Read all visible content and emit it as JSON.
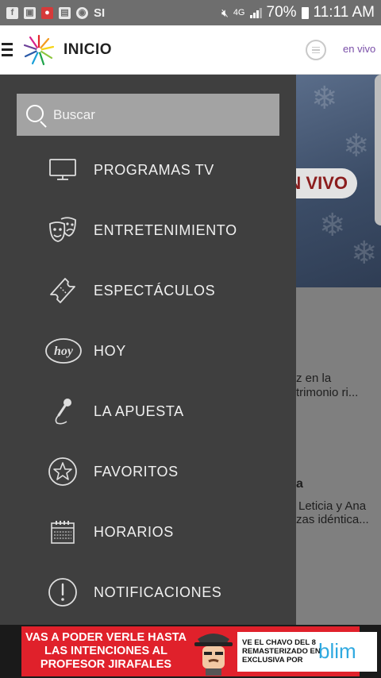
{
  "status_bar": {
    "left_icons": [
      "facebook-icon",
      "image-icon",
      "app-icon",
      "clipboard-icon",
      "cbs-icon",
      "si-icon"
    ],
    "si_text": "SI",
    "network": "4G",
    "battery_percent": "70%",
    "time": "11:11 AM"
  },
  "header": {
    "title": "INICIO",
    "live_link": "en vivo"
  },
  "search": {
    "placeholder": "Buscar"
  },
  "menu": {
    "items": [
      {
        "label": "PROGRAMAS TV",
        "icon": "tv-icon"
      },
      {
        "label": "ENTRETENIMIENTO",
        "icon": "theater-masks-icon"
      },
      {
        "label": "ESPECTÁCULOS",
        "icon": "ticket-icon"
      },
      {
        "label": "HOY",
        "icon": "hoy-logo-icon"
      },
      {
        "label": "LA APUESTA",
        "icon": "microphone-icon"
      },
      {
        "label": "FAVORITOS",
        "icon": "star-icon"
      },
      {
        "label": "HORARIOS",
        "icon": "calendar-icon"
      },
      {
        "label": "NOTIFICACIONES",
        "icon": "alert-icon"
      }
    ]
  },
  "background": {
    "live_badge": "N VIVO",
    "snippet1_line1": "z en la",
    "snippet1_line2": "trimonio ri...",
    "snippet2_title": "a",
    "snippet2_line1": "Leticia y Ana",
    "snippet2_line2": "zas idéntica..."
  },
  "ad": {
    "headline_line1": "VAS A PODER VERLE HASTA",
    "headline_line2": "LAS INTENCIONES AL",
    "headline_line3": "PROFESOR JIRAFALES",
    "small_line1": "VE EL CHAVO DEL 8",
    "small_line2": "REMASTERIZADO EN",
    "small_line3": "EXCLUSIVA POR",
    "brand": "blim",
    "colors": {
      "background": "#e0212b",
      "brand": "#2fa9e0"
    }
  },
  "colors": {
    "drawer": "#3f3f3f",
    "search_bar": "#a3a3a3",
    "accent_purple": "#7a4fa8",
    "status_bar": "#6e6e6e"
  }
}
